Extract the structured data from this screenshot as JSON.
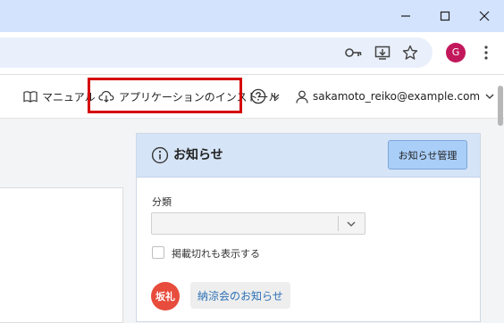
{
  "window": {
    "controls": [
      "minimize-icon",
      "maximize-icon",
      "close-icon"
    ]
  },
  "toolbar": {
    "icons": [
      "key-icon",
      "download-icon",
      "star-icon",
      "more-vert-icon"
    ],
    "profile_initial": "G"
  },
  "nav": {
    "manual": "マニュアル",
    "install": "アプリケーションのインストール",
    "user": "sakamoto_reiko@example.com"
  },
  "notice": {
    "title": "お知らせ",
    "manage_button": "お知らせ管理",
    "category_label": "分類",
    "category_value": "",
    "show_expired_label": "掲載切れも表示する",
    "items": [
      {
        "avatar": "坂礼",
        "title": "納涼会のお知らせ"
      }
    ]
  },
  "colors": {
    "titlebar": "#d3e3fd",
    "highlight": "#d50000",
    "notice_header": "#d6e4f7",
    "manage_button": "#a9cef8",
    "avatar": "#e74c3c",
    "link": "#2a6fb4"
  }
}
